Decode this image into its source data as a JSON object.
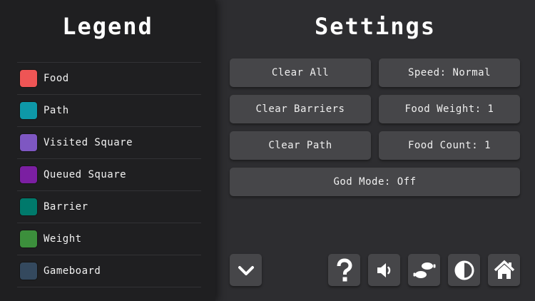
{
  "legend": {
    "title": "Legend",
    "items": [
      {
        "label": "Food",
        "color": "#ee5555"
      },
      {
        "label": "Path",
        "color": "#0e98a8"
      },
      {
        "label": "Visited Square",
        "color": "#7e57c2"
      },
      {
        "label": "Queued Square",
        "color": "#7b1fa2"
      },
      {
        "label": "Barrier",
        "color": "#00796b"
      },
      {
        "label": "Weight",
        "color": "#3c8f3c"
      },
      {
        "label": "Gameboard",
        "color": "#34495e"
      }
    ]
  },
  "settings": {
    "title": "Settings",
    "clear_all": "Clear All",
    "speed": "Speed: Normal",
    "clear_barriers": "Clear Barriers",
    "food_weight": "Food Weight: 1",
    "clear_path": "Clear Path",
    "food_count": "Food Count: 1",
    "god_mode": "God Mode: Off"
  },
  "toolbar": {
    "icons": [
      "chevron-down-icon",
      "question-icon",
      "speaker-icon",
      "footprints-icon",
      "contrast-icon",
      "home-icon"
    ]
  }
}
